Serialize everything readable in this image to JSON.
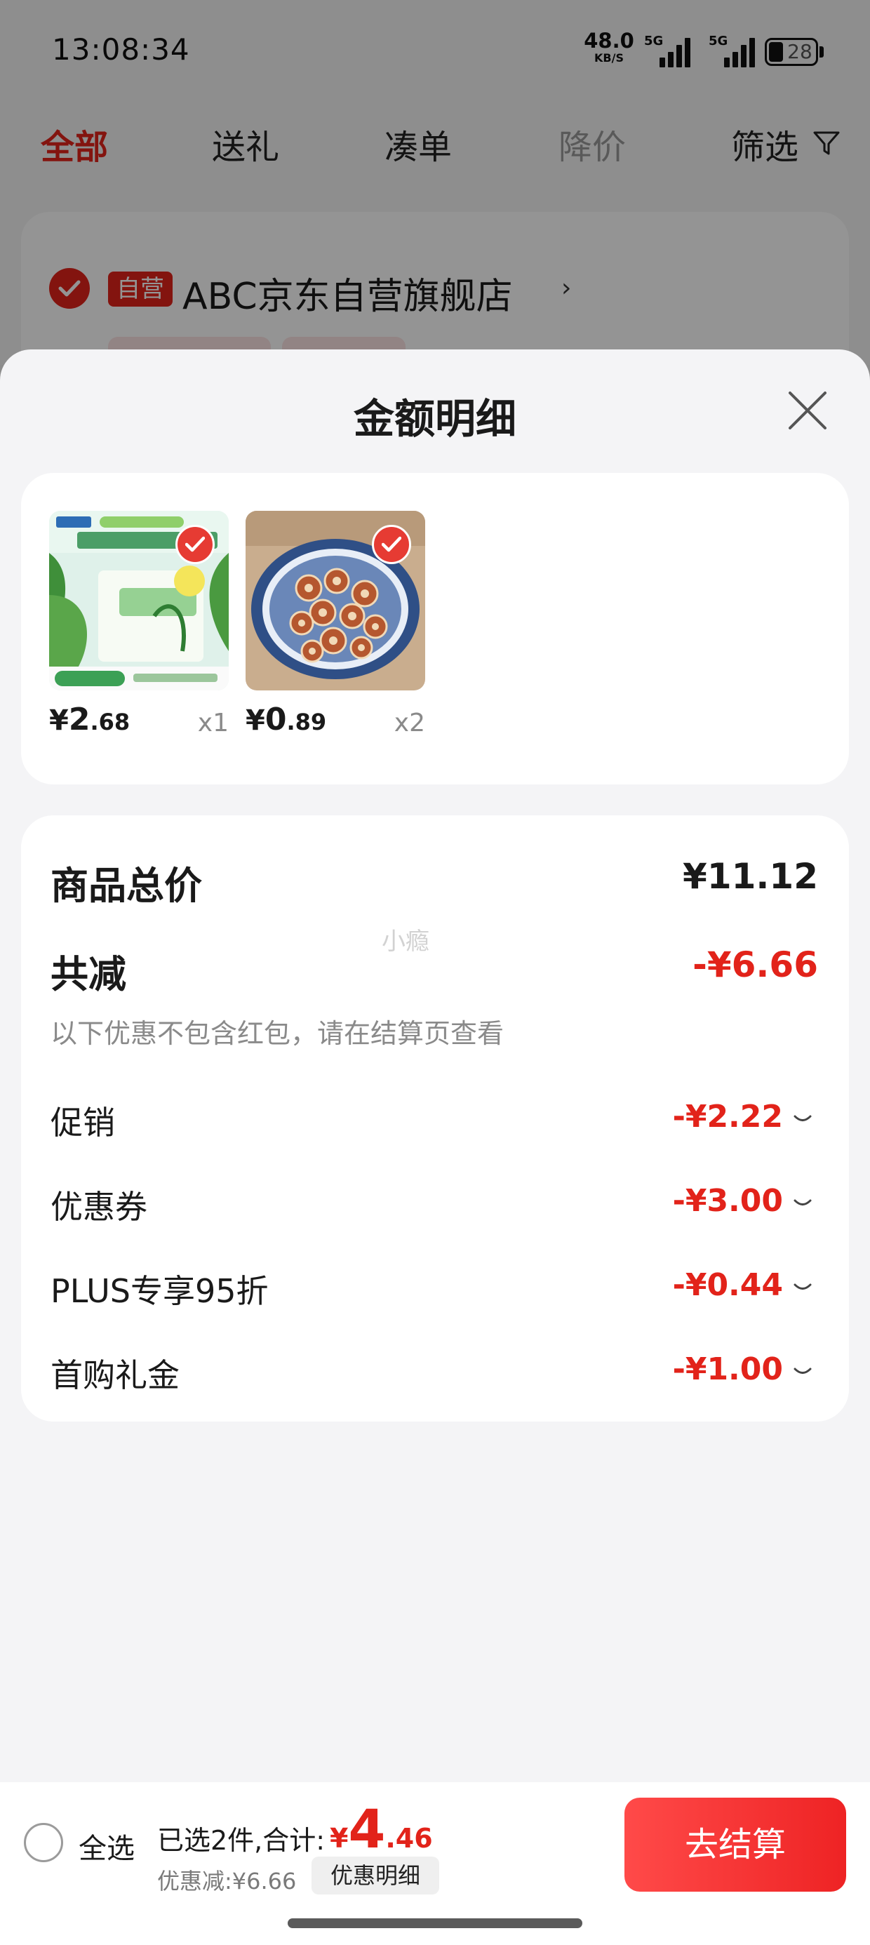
{
  "status_bar": {
    "time": "13:08:34",
    "net_speed": "48.0",
    "net_unit": "KB/S",
    "sim1": "5G",
    "sim2": "5G",
    "battery": "28"
  },
  "tabs": [
    {
      "label": "全部",
      "state": "active"
    },
    {
      "label": "送礼",
      "state": "normal"
    },
    {
      "label": "凑单",
      "state": "normal"
    },
    {
      "label": "降价",
      "state": "disabled"
    },
    {
      "label": "筛选",
      "state": "normal"
    }
  ],
  "store": {
    "badge": "自营",
    "name": "ABC京东自营旗舰店",
    "chevron": "›"
  },
  "sheet": {
    "title": "金额明细"
  },
  "products": [
    {
      "price_yen": "¥",
      "price_int": "2",
      "price_dec": ".68",
      "qty": "x1",
      "checked": true,
      "icon": "check-icon"
    },
    {
      "price_yen": "¥",
      "price_int": "0",
      "price_dec": ".89",
      "qty": "x2",
      "checked": true,
      "icon": "check-icon"
    }
  ],
  "summary": {
    "total_label": "商品总价",
    "total_value": "¥11.12",
    "watermark": "小瘾",
    "reduce_label": "共减",
    "reduce_value": "-¥6.66",
    "note": "以下优惠不包含红包，请在结算页查看",
    "items": [
      {
        "label": "促销",
        "value": "-¥2.22"
      },
      {
        "label": "优惠券",
        "value": "-¥3.00"
      },
      {
        "label": "PLUS专享95折",
        "value": "-¥0.44"
      },
      {
        "label": "首购礼金",
        "value": "-¥1.00"
      }
    ]
  },
  "bottom_bar": {
    "select_all": "全选",
    "selected_text": "已选2件,合计:",
    "total_yen": "¥",
    "total_int": "4",
    "total_dec": ".46",
    "discount_text": "优惠减:¥6.66",
    "detail_chip": "优惠明细",
    "checkout": "去结算"
  },
  "colors": {
    "accent_red": "#e2231a",
    "overlay": "rgba(0,0,0,0.42)",
    "sheet_bg": "#f4f4f6"
  }
}
